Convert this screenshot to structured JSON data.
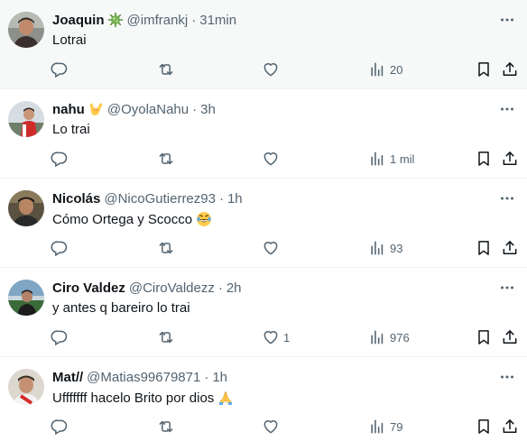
{
  "colors": {
    "text": "#0f1419",
    "secondary": "#536471",
    "divider": "#eff3f4",
    "highlight_bg": "#f7f9f9"
  },
  "tweets": [
    {
      "name": "Joaquin",
      "badge_icon": "virus-emoji-icon",
      "handle": "@imfrankj",
      "separator": "·",
      "time": "31min",
      "text": "Lotrai",
      "text_emoji": "",
      "likes": "",
      "views": "20"
    },
    {
      "name": "nahu",
      "badge_icon": "call-me-hand-emoji-icon",
      "handle": "@OyolaNahu",
      "separator": "·",
      "time": "3h",
      "text": "Lo trai",
      "text_emoji": "",
      "likes": "",
      "views": "1 mil"
    },
    {
      "name": "Nicolás",
      "badge_icon": "",
      "handle": "@NicoGutierrez93",
      "separator": "·",
      "time": "1h",
      "text": "Cómo Ortega y Scocco",
      "text_emoji": "rolling-laughing-emoji-icon",
      "likes": "",
      "views": "93"
    },
    {
      "name": "Ciro Valdez",
      "badge_icon": "",
      "handle": "@CiroValdezz",
      "separator": "·",
      "time": "2h",
      "text": "y antes q bareiro lo trai",
      "text_emoji": "",
      "likes": "1",
      "views": "976"
    },
    {
      "name": "Mat//",
      "badge_icon": "",
      "handle": "@Matias99679871",
      "separator": "·",
      "time": "1h",
      "text": "Ufffffff hacelo Brito por dios",
      "text_emoji": "folded-hands-emoji-icon",
      "likes": "",
      "views": "79"
    }
  ]
}
